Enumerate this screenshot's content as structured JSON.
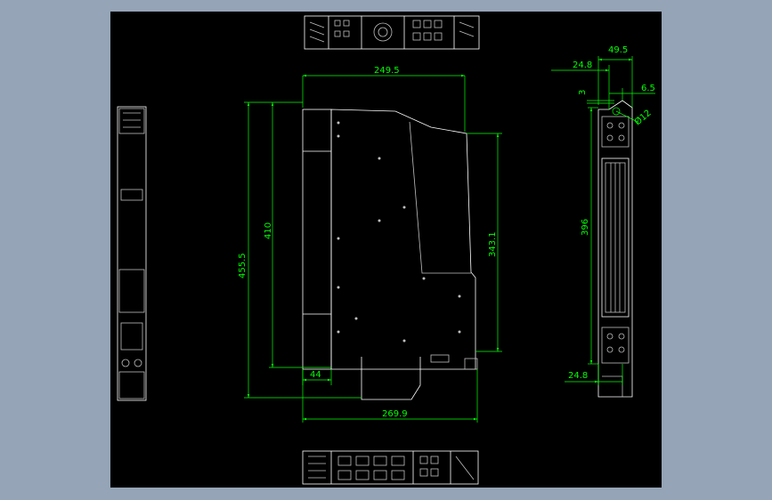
{
  "viewport": {
    "background": "#95a4b6",
    "drawing_background": "#000000"
  },
  "colors": {
    "dimension": "#00ff00",
    "outline": "#ffffff",
    "detail": "#bfbfbf"
  },
  "dimensions": {
    "top_width": "249.5",
    "height_overall": "455.5",
    "height_body": "410",
    "height_right": "343.1",
    "foot_width": "44",
    "bottom_width": "269.9",
    "side_width_total": "49.5",
    "side_width_offset": "24.8",
    "side_hole_offset": "3",
    "side_hole_right": "6.5",
    "side_hole_dia": "Ø12",
    "side_height": "396",
    "side_bottom_width": "24.8"
  }
}
